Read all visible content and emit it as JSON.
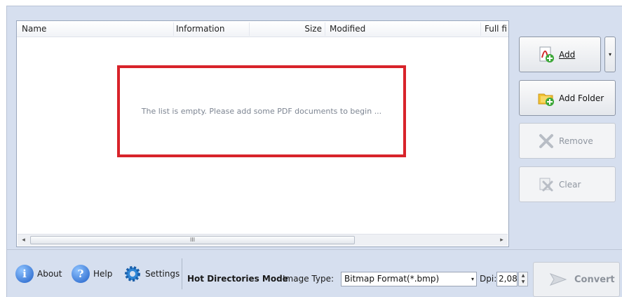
{
  "list": {
    "columns": [
      "Name",
      "Information",
      "Size",
      "Modified",
      "Full fil"
    ],
    "empty_message": "The list is empty. Please add some PDF documents to begin ...",
    "scroll_thumb_label": "III",
    "scroll_left": "◂",
    "scroll_right": "▸"
  },
  "side": {
    "add_label": "Add",
    "add_folder_label": "Add Folder",
    "remove_label": "Remove",
    "clear_label": "Clear",
    "dropdown_glyph": "▾"
  },
  "bottom": {
    "about_label": "About",
    "help_label": "Help",
    "settings_label": "Settings",
    "hot_dirs_label": "Hot Directories Mode",
    "image_type_label": "Image Type:",
    "image_type_value": "Bitmap Format(*.bmp)",
    "dpi_label": "Dpi:",
    "dpi_value": "2,08",
    "convert_label": "Convert",
    "about_glyph": "i",
    "help_glyph": "?",
    "caret_glyph": "▾",
    "spin_up": "▲",
    "spin_down": "▼"
  },
  "colors": {
    "highlight_frame": "#d8232a",
    "panel_bg": "#d6dfef"
  }
}
